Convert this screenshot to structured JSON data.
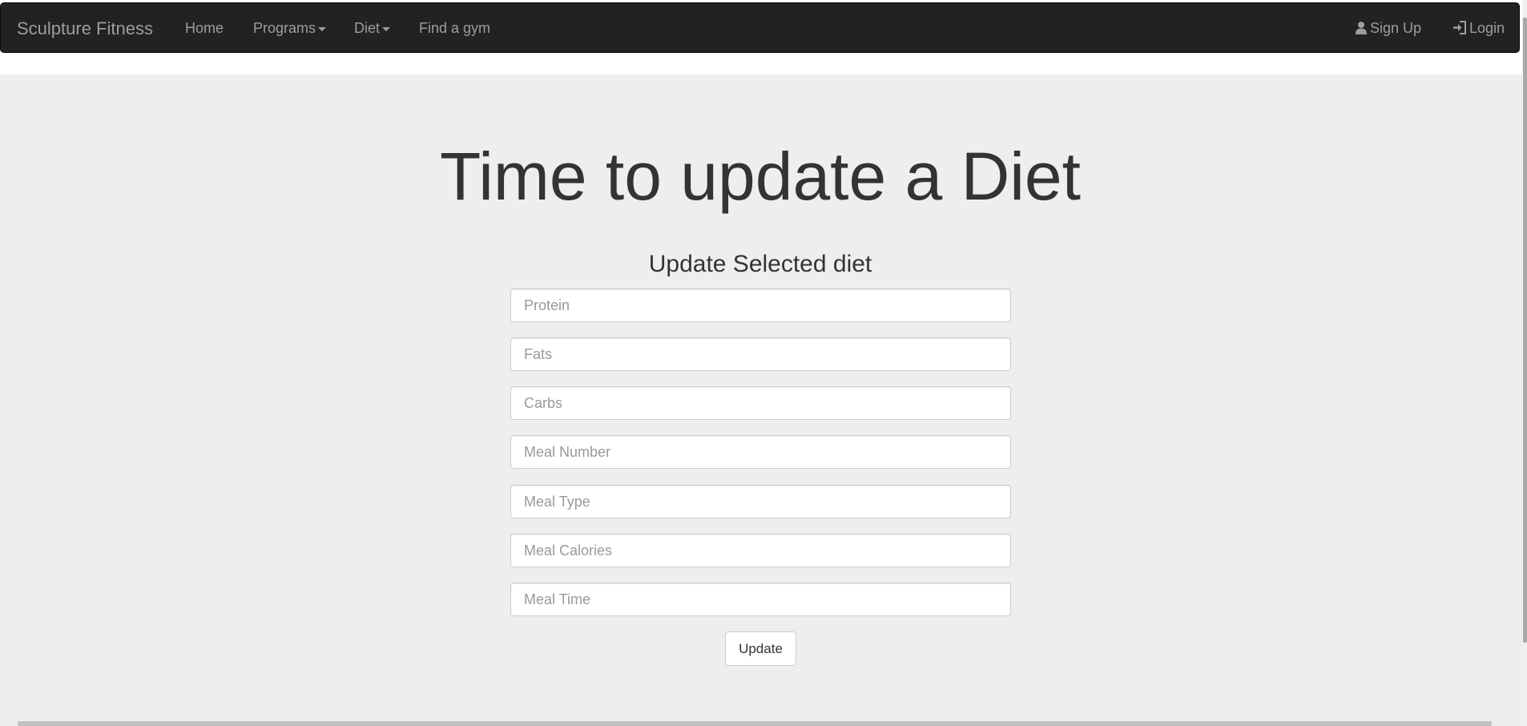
{
  "navbar": {
    "brand": "Sculpture Fitness",
    "items": [
      {
        "label": "Home"
      },
      {
        "label": "Programs"
      },
      {
        "label": "Diet"
      },
      {
        "label": "Find a gym"
      }
    ],
    "right": {
      "signup_label": "Sign Up",
      "login_label": "Login",
      "signup_icon": "user-icon",
      "login_icon": "log-in-icon"
    }
  },
  "main": {
    "title": "Time to update a Diet",
    "form_title": "Update Selected diet",
    "fields": [
      {
        "placeholder": "Protein",
        "value": ""
      },
      {
        "placeholder": "Fats",
        "value": ""
      },
      {
        "placeholder": "Carbs",
        "value": ""
      },
      {
        "placeholder": "Meal Number",
        "value": ""
      },
      {
        "placeholder": "Meal Type",
        "value": ""
      },
      {
        "placeholder": "Meal Calories",
        "value": ""
      },
      {
        "placeholder": "Meal Time",
        "value": ""
      }
    ],
    "submit_label": "Update"
  },
  "colors": {
    "navbar_bg": "#222222",
    "nav_text": "#9d9d9d",
    "jumbotron_bg": "#eeeeee",
    "text": "#333333"
  }
}
